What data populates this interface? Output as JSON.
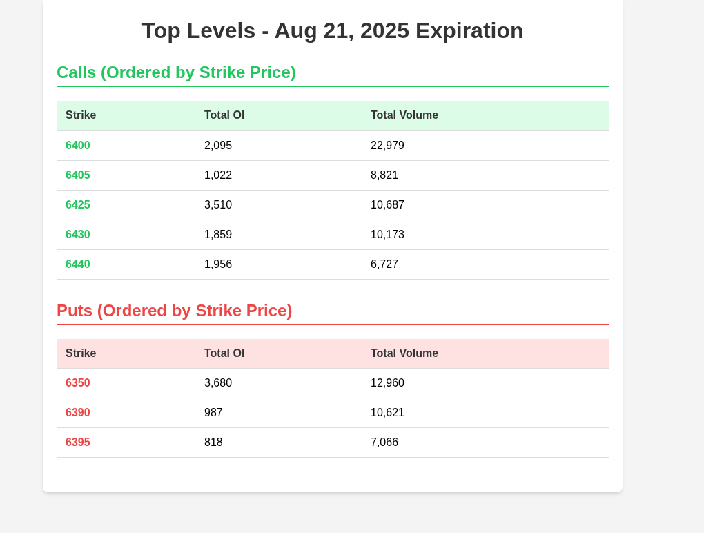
{
  "title": "Top Levels - Aug 21, 2025 Expiration",
  "sections": [
    {
      "kind": "calls",
      "heading": "Calls (Ordered by Strike Price)",
      "columns": [
        "Strike",
        "Total OI",
        "Total Volume"
      ],
      "rows": [
        [
          "6400",
          "2,095",
          "22,979"
        ],
        [
          "6405",
          "1,022",
          "8,821"
        ],
        [
          "6425",
          "3,510",
          "10,687"
        ],
        [
          "6430",
          "1,859",
          "10,173"
        ],
        [
          "6440",
          "1,956",
          "6,727"
        ]
      ]
    },
    {
      "kind": "puts",
      "heading": "Puts (Ordered by Strike Price)",
      "columns": [
        "Strike",
        "Total OI",
        "Total Volume"
      ],
      "rows": [
        [
          "6350",
          "3,680",
          "12,960"
        ],
        [
          "6390",
          "987",
          "10,621"
        ],
        [
          "6395",
          "818",
          "7,066"
        ]
      ]
    }
  ]
}
